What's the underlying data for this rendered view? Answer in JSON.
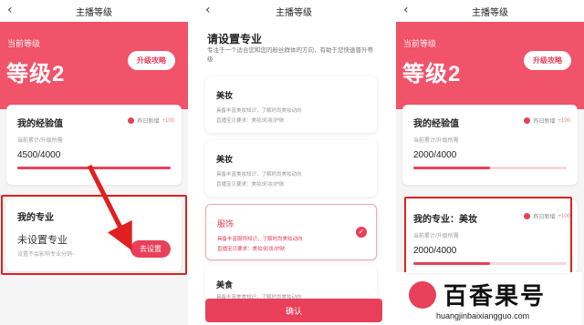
{
  "panel1": {
    "nav_title": "主播等级",
    "back_icon": "chevron-left-icon",
    "hero": {
      "label": "当前等级",
      "level": "等级2",
      "strategy_btn": "升级攻略",
      "color": "#f0536a"
    },
    "exp_card": {
      "title": "我的经验值",
      "today_label": "昨日新增",
      "today_value": "+100",
      "sub": "当前累计/升级所需",
      "value": "4500/4000",
      "progress": 1.0
    },
    "specialty_card": {
      "title": "我的专业",
      "status": "未设置专业",
      "hint": "设置不会影响专业分销~",
      "set_btn": "去设置"
    }
  },
  "panel2": {
    "back_icon": "chevron-left-icon",
    "nav_title": "主播等级",
    "title": "请设置专业",
    "desc": "专注于一个适合您和您的粉丝群体的方向，有助于您快速晋升等级",
    "options": [
      {
        "name": "美妆",
        "line1": "具备丰富美妆知识，了解时尚美妆动向",
        "line2": "直播宝贝要求：美妆/彩妆/护肤",
        "selected": false
      },
      {
        "name": "美妆",
        "line1": "具备丰富美妆知识，了解时尚美妆动向",
        "line2": "直播宝贝要求：美妆/彩妆/护肤",
        "selected": false
      },
      {
        "name": "服饰",
        "line1": "具备丰富服饰知识，了解时尚美妆动向",
        "line2": "直播宝贝要求：美妆/彩妆/护肤",
        "selected": true
      },
      {
        "name": "美食",
        "line1": "具备丰富美食知识，了解时尚美妆动向",
        "line2": "",
        "selected": false
      }
    ],
    "confirm_btn": "确认",
    "accent": "#e8405a"
  },
  "panel3": {
    "nav_title": "主播等级",
    "back_icon": "chevron-left-icon",
    "hero": {
      "label": "当前等级",
      "level": "等级2",
      "strategy_btn": "升级攻略"
    },
    "exp_card": {
      "title": "我的经验值",
      "today_label": "昨日新增",
      "today_value": "+100",
      "sub": "当前累计/升级所需",
      "value": "2000/4000",
      "progress": 0.5
    },
    "specialty_card": {
      "title": "我的专业：美妆",
      "today_label": "昨日新增",
      "today_value": "+100",
      "sub": "当前累计/升级所需",
      "value": "2000/4000",
      "progress": 0.5
    }
  },
  "watermark": {
    "name": "百香果号",
    "url": "huangjinbaixiangguo.com"
  }
}
